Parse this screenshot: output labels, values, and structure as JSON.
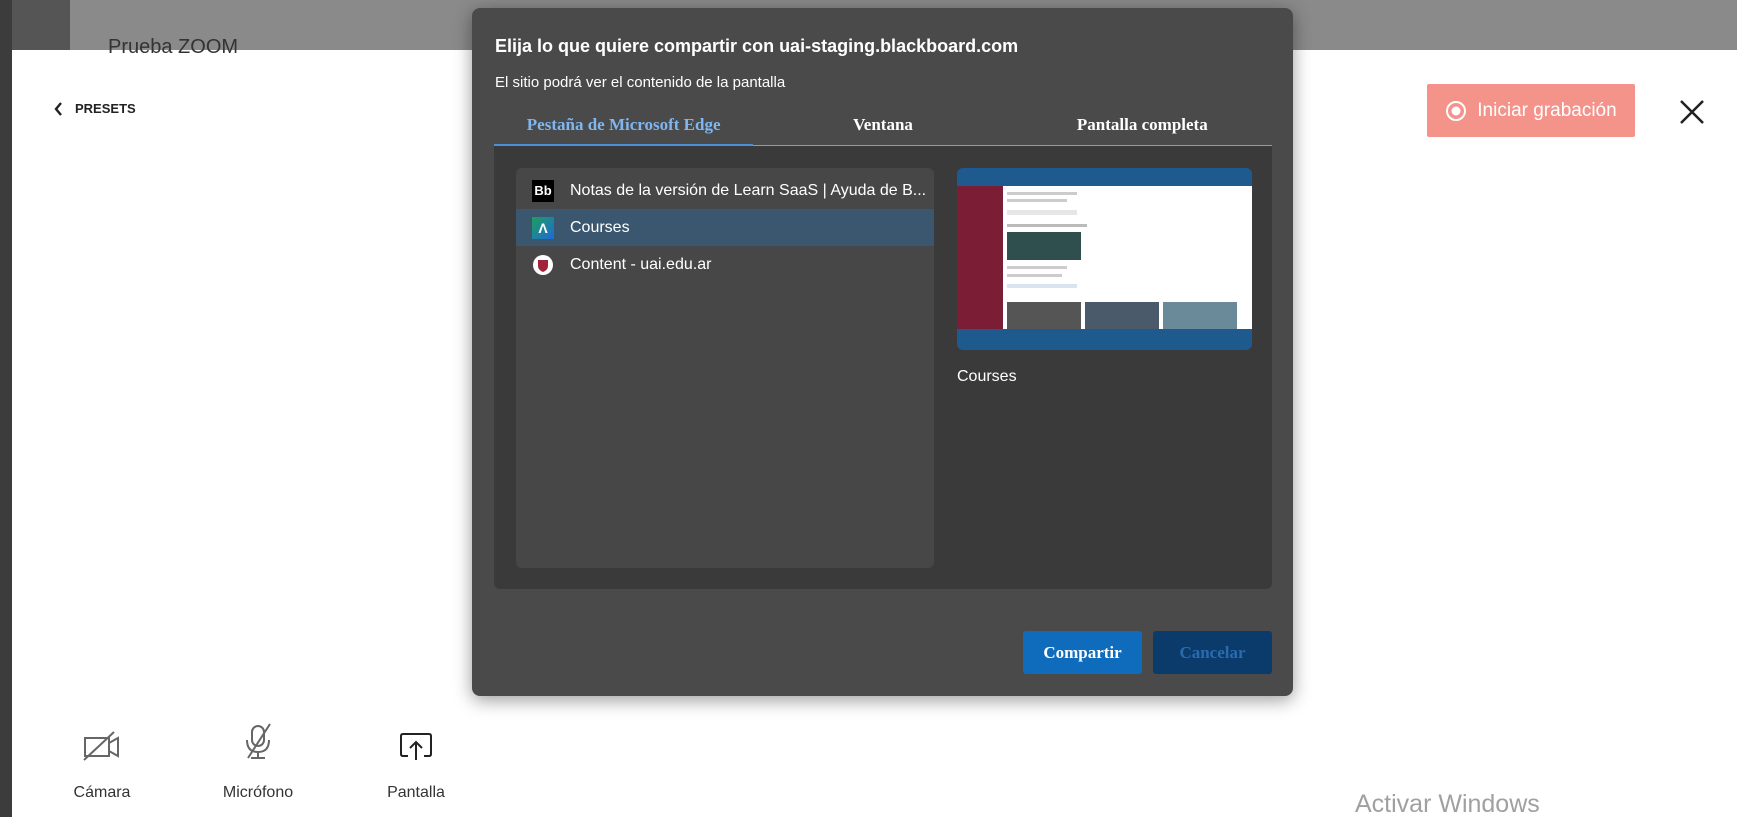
{
  "background": {
    "window_title": "Prueba ZOOM",
    "presets_label": "PRESETS",
    "record_label": "Iniciar grabación",
    "controls": [
      {
        "label": "Cámara",
        "icon": "camera-off-icon"
      },
      {
        "label": "Micrófono",
        "icon": "mic-off-icon"
      },
      {
        "label": "Pantalla",
        "icon": "share-screen-icon"
      }
    ],
    "watermark": "Activar Windows"
  },
  "dialog": {
    "title": "Elija lo que quiere compartir con uai-staging.blackboard.com",
    "subtitle": "El sitio podrá ver el contenido de la pantalla",
    "tabs": [
      {
        "label": "Pestaña de Microsoft Edge",
        "active": true
      },
      {
        "label": "Ventana",
        "active": false
      },
      {
        "label": "Pantalla completa",
        "active": false
      }
    ],
    "items": [
      {
        "icon_text": "Bb",
        "label": "Notas de la versión de Learn SaaS | Ayuda de B...",
        "selected": false
      },
      {
        "icon_text": "Λ",
        "label": "Courses",
        "selected": true
      },
      {
        "icon_text": "",
        "label": "Content - uai.edu.ar",
        "selected": false
      }
    ],
    "preview_label": "Courses",
    "share_label": "Compartir",
    "cancel_label": "Cancelar"
  },
  "colors": {
    "accent": "#0f6cbd",
    "record": "#f4938a",
    "selected_row": "#3b5770",
    "active_tab": "#7fb6f0"
  }
}
